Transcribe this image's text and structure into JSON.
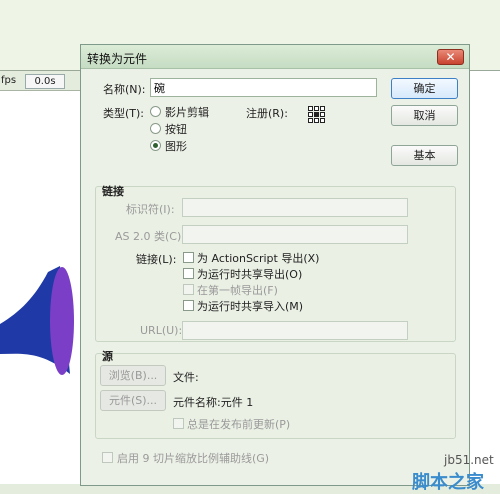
{
  "statusbar": {
    "fps": "fps",
    "fps_value": "0.0s"
  },
  "dialog": {
    "title": "转换为元件",
    "close_glyph": "✕",
    "name_label": "名称(N):",
    "name_value": "碗",
    "type_label": "类型(T):",
    "type_options": [
      "影片剪辑",
      "按钮",
      "图形"
    ],
    "type_selected": "图形",
    "registration_label": "注册(R):",
    "buttons": {
      "ok": "确定",
      "cancel": "取消",
      "basic": "基本"
    },
    "linkage": {
      "title": "链接",
      "identifier_label": "标识符(I):",
      "as_class_label": "AS 2.0 类(C):",
      "linkage_label": "链接(L):",
      "options": [
        "为 ActionScript 导出(X)",
        "为运行时共享导出(O)",
        "在第一帧导出(F)",
        "为运行时共享导入(M)"
      ],
      "url_label": "URL(U):"
    },
    "source": {
      "title": "源",
      "browse_button": "浏览(B)...",
      "file_label": "文件:",
      "symbol_button": "元件(S)...",
      "symbol_name": "元件名称:元件 1",
      "always_update": "总是在发布前更新(P)"
    },
    "nine_slice": "启用 9 切片缩放比例辅助线(G)"
  },
  "watermark": {
    "site": "jb51.net",
    "name": "脚本之家"
  },
  "colors": {
    "shape_dark": "#1f3aa6",
    "shape_light": "#7a3fc6",
    "default_button_border": "#3e80c6"
  }
}
